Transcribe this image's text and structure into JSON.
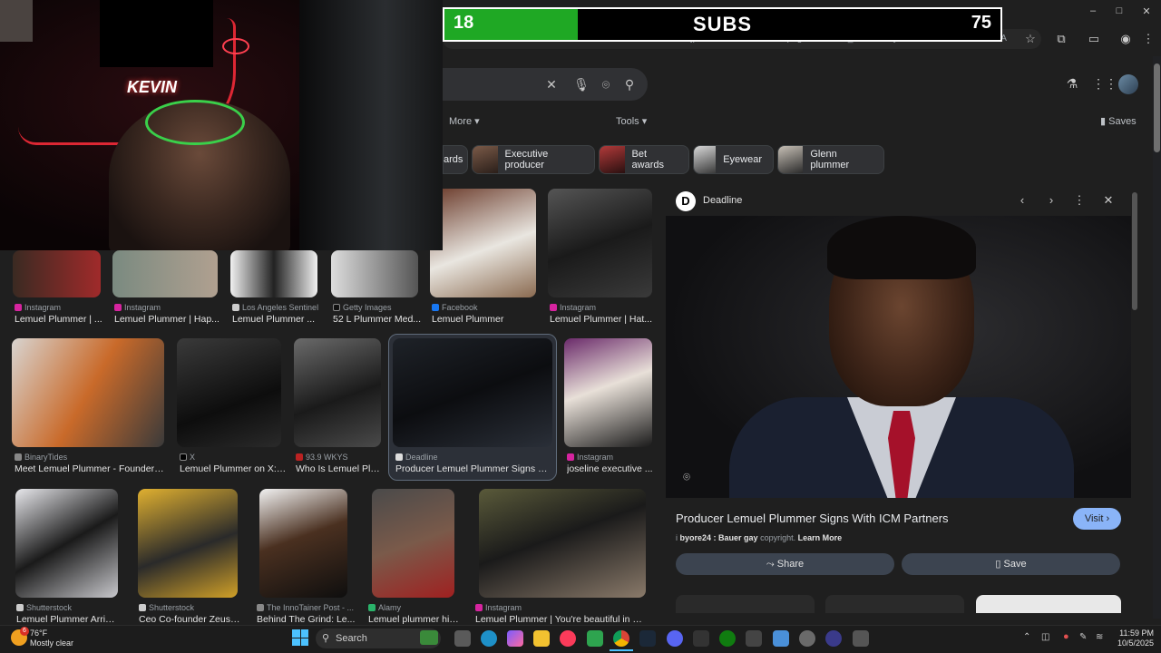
{
  "browser": {
    "url": "hA-1759723198758&udm=2&fbs=AIIjpHxU7SXXniUZfeShr2fp4giZ1Y6MJ25_tmWITc7uy4KleuYzfkfneXafNx6OMdA",
    "window_controls": [
      "–",
      "□",
      "✕"
    ]
  },
  "sub_counter": {
    "current": "18",
    "title": "SUBS",
    "goal": "75",
    "progress": 0.24
  },
  "webcam": {
    "sign_text": "KEVIN"
  },
  "search": {
    "tools": {
      "more": "More",
      "tools": "Tools",
      "saves": "Saves"
    }
  },
  "chips": [
    {
      "label": "ards"
    },
    {
      "label": "Executive producer"
    },
    {
      "label": "Bet awards"
    },
    {
      "label": "Eyewear"
    },
    {
      "label": "Glenn plummer"
    }
  ],
  "results": {
    "row1": [
      {
        "source": "Instagram",
        "title": "Lemuel Plummer | ..."
      },
      {
        "source": "Instagram",
        "title": "Lemuel Plummer | Hap..."
      },
      {
        "source": "Los Angeles Sentinel",
        "title": "Lemuel Plummer ..."
      },
      {
        "source": "Getty Images",
        "title": "52 L Plummer Med..."
      },
      {
        "source": "Facebook",
        "title": "Lemuel Plummer"
      },
      {
        "source": "Instagram",
        "title": "Lemuel Plummer | Hat..."
      }
    ],
    "row2": [
      {
        "source": "BinaryTides",
        "title": "Meet Lemuel Plummer - Founder & ..."
      },
      {
        "source": "X",
        "title": "Lemuel Plummer on X: ..."
      },
      {
        "source": "93.9 WKYS",
        "title": "Who Is Lemuel Plu..."
      },
      {
        "source": "Deadline",
        "title": "Producer Lemuel Plummer Signs Wit..."
      },
      {
        "source": "Instagram",
        "title": "joseline executive ..."
      }
    ],
    "row3": [
      {
        "source": "Shutterstock",
        "title": "Lemuel Plummer Arrives..."
      },
      {
        "source": "Shutterstock",
        "title": "Ceo Co-founder Zeus N..."
      },
      {
        "source": "The InnoTainer Post - ...",
        "title": "Behind The Grind: Le..."
      },
      {
        "source": "Alamy",
        "title": "Lemuel plummer hi-r..."
      },
      {
        "source": "Instagram",
        "title": "Lemuel Plummer | You're beautiful in so ..."
      }
    ]
  },
  "preview": {
    "source": "Deadline",
    "logo_letter": "D",
    "title": "Producer Lemuel Plummer Signs With ICM Partners",
    "visit": "Visit",
    "note_prefix": "i",
    "note_overlay": "byore24 : Bauer gay",
    "note_suffix": "copyright.",
    "learn_more": "Learn More",
    "share": "Share",
    "save": "Save"
  },
  "taskbar": {
    "weather_temp": "76°F",
    "weather_desc": "Mostly clear",
    "weather_badge": "6",
    "search_label": "Search",
    "time": "11:59 PM",
    "date": "10/5/2025"
  }
}
